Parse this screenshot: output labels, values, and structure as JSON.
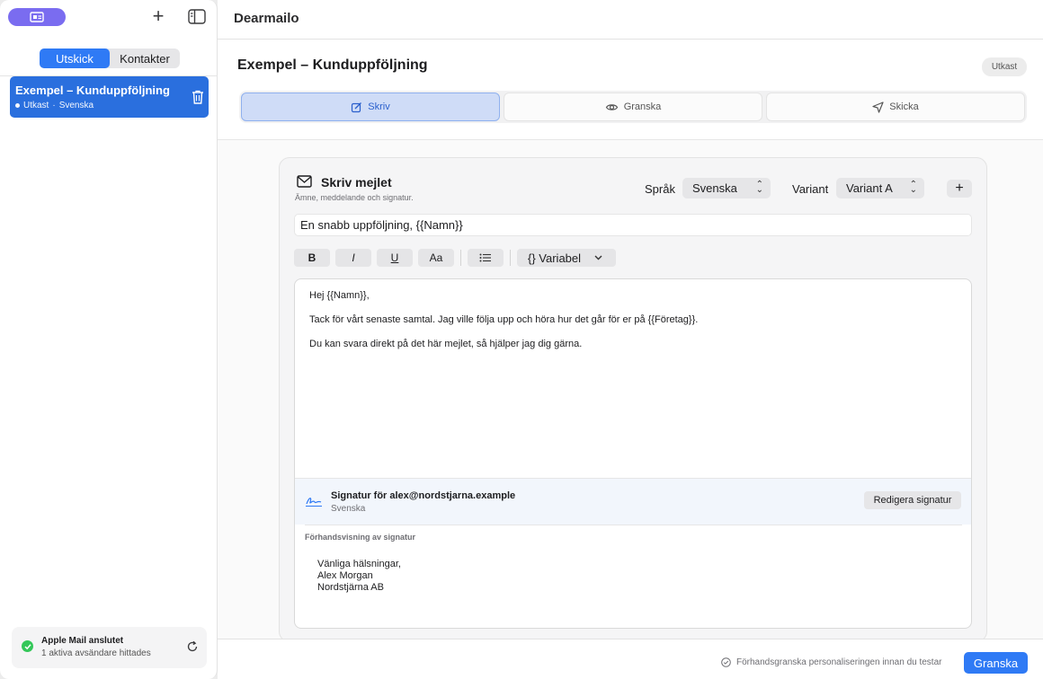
{
  "app": {
    "title": "Dearmailo"
  },
  "sidebar": {
    "segments": [
      {
        "label": "Utskick"
      },
      {
        "label": "Kontakter"
      }
    ],
    "items": [
      {
        "title": "Exempel – Kunduppföljning",
        "status": "Utkast",
        "sep": "·",
        "language": "Svenska"
      }
    ],
    "connection": {
      "title": "Apple Mail anslutet",
      "subtitle": "1 aktiva avsändare hittades"
    }
  },
  "page": {
    "title": "Exempel – Kunduppföljning",
    "badge": "Utkast"
  },
  "tabs": [
    {
      "label": "Skriv"
    },
    {
      "label": "Granska"
    },
    {
      "label": "Skicka"
    }
  ],
  "composer": {
    "title": "Skriv mejlet",
    "subtitle": "Ämne, meddelande och signatur.",
    "language_label": "Språk",
    "language_value": "Svenska",
    "variant_label": "Variant",
    "variant_value": "Variant A",
    "add_label": "+",
    "subject": "En snabb uppföljning, {{Namn}}",
    "toolbar": {
      "bold": "B",
      "italic": "I",
      "underline": "U",
      "case": "Aa",
      "variable": "{} Variabel"
    },
    "body": [
      "Hej {{Namn}},",
      "Tack för vårt senaste samtal. Jag ville följa upp och höra hur det går för er på {{Företag}}.",
      "Du kan svara direkt på det här mejlet, så hjälper jag dig gärna."
    ],
    "signature": {
      "title": "Signatur för alex@nordstjarna.example",
      "language": "Svenska",
      "edit_label": "Redigera signatur",
      "preview_label": "Förhandsvisning av signatur",
      "lines": [
        "Vänliga hälsningar,",
        "Alex Morgan",
        "Nordstjärna AB"
      ]
    }
  },
  "footer": {
    "info": "Förhandsgranska personaliseringen innan du testar",
    "primary_label": "Granska"
  },
  "colors": {
    "accent": "#2f7af5",
    "sidebar_selected": "#2a6fde",
    "pill": "#7a6cf0",
    "ok": "#34c759"
  }
}
